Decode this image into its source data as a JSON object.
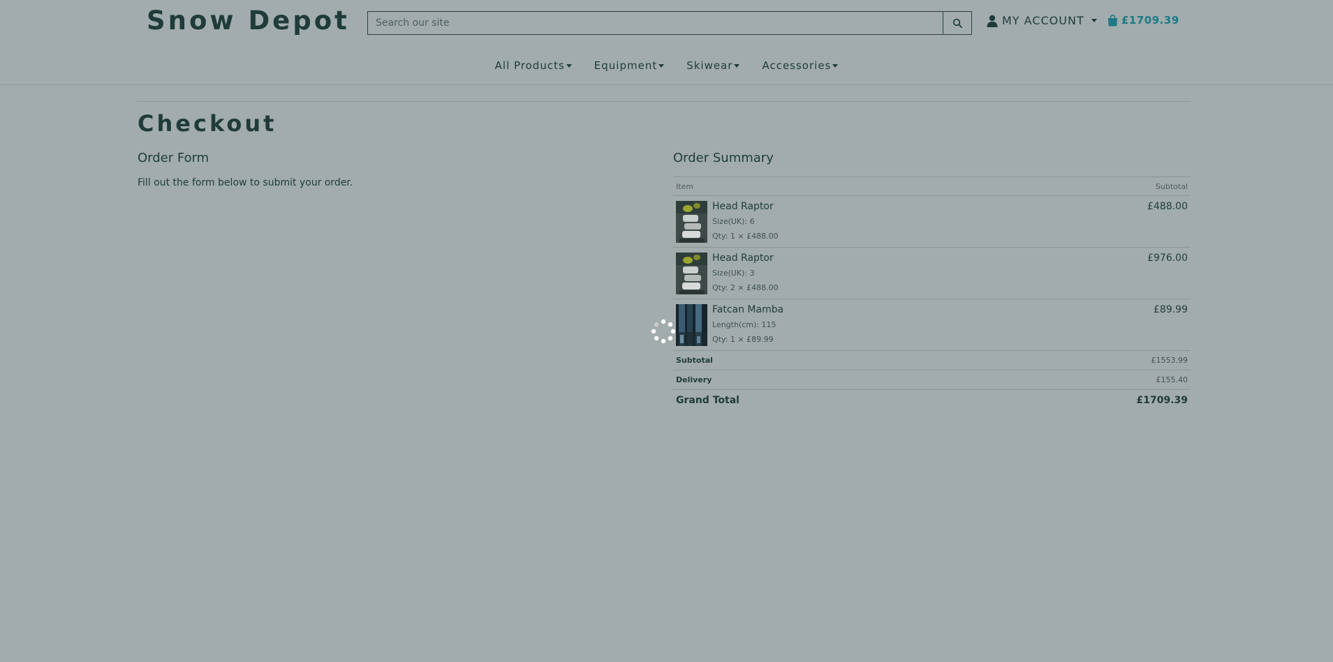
{
  "header": {
    "logo": "Snow Depot",
    "search_placeholder": "Search our site",
    "account_label": "MY ACCOUNT",
    "cart_total": "£1709.39"
  },
  "nav": {
    "items": [
      {
        "label": "All Products"
      },
      {
        "label": "Equipment"
      },
      {
        "label": "Skiwear"
      },
      {
        "label": "Accessories"
      }
    ]
  },
  "page": {
    "title": "Checkout"
  },
  "order_form": {
    "heading": "Order Form",
    "text": "Fill out the form below to submit your order."
  },
  "summary": {
    "heading": "Order Summary",
    "col_item": "Item",
    "col_subtotal": "Subtotal",
    "items": [
      {
        "name": "Head Raptor",
        "detail": "Size(UK): 6",
        "qty": "Qty: 1 × £488.00",
        "subtotal": "£488.00"
      },
      {
        "name": "Head Raptor",
        "detail": "Size(UK): 3",
        "qty": "Qty: 2 × £488.00",
        "subtotal": "£976.00"
      },
      {
        "name": "Fatcan Mamba",
        "detail": "Length(cm): 115",
        "qty": "Qty: 1 × £89.99",
        "subtotal": "£89.99"
      }
    ],
    "subtotal_label": "Subtotal",
    "subtotal_value": "£1553.99",
    "delivery_label": "Delivery",
    "delivery_value": "£155.40",
    "grand_total_label": "Grand Total",
    "grand_total_value": "£1709.39"
  },
  "colors": {
    "background": "#a2acac",
    "text": "#1f3b3a",
    "accent": "#1c7a86"
  },
  "icons": {
    "search": "search-icon",
    "account": "user-icon",
    "cart": "shopping-bag-icon",
    "loading": "loading-spinner-icon"
  }
}
